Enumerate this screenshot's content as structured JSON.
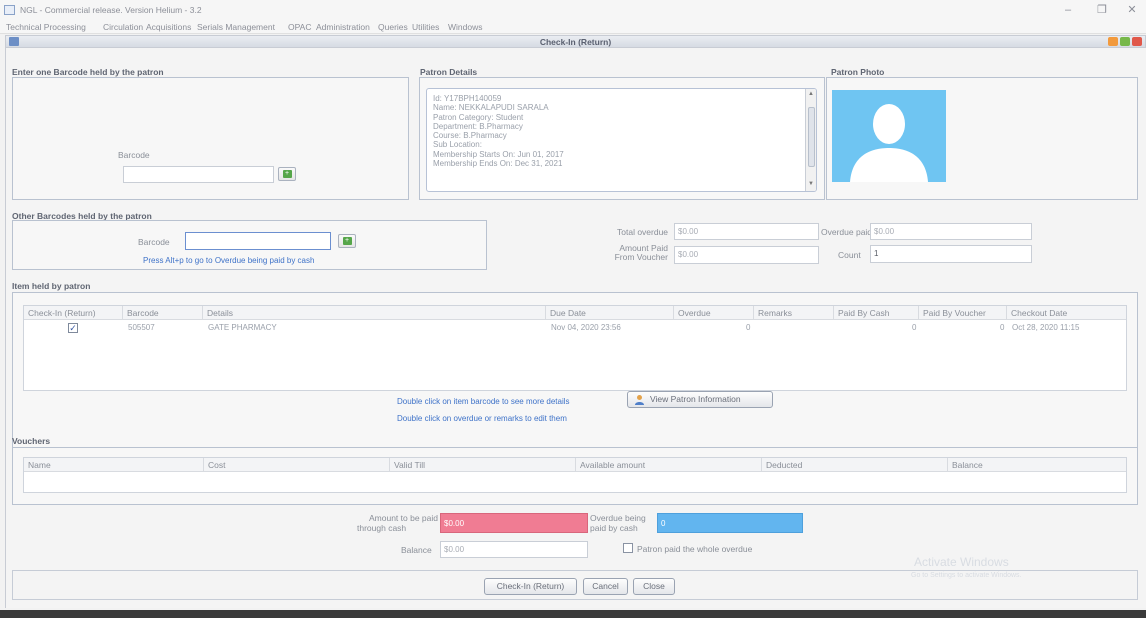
{
  "window": {
    "title": "NGL - Commercial release. Version Helium - 3.2"
  },
  "menu": [
    "Technical Processing",
    "Circulation",
    "Acquisitions",
    "Serials Management",
    "OPAC",
    "Administration",
    "Queries",
    "Utilities",
    "Windows"
  ],
  "dialog": {
    "title": "Check-In (Return)"
  },
  "barcode_section": {
    "title": "Enter one Barcode held by the patron",
    "label": "Barcode",
    "value": ""
  },
  "patron_details": {
    "title": "Patron Details",
    "lines": [
      "Id: Y17BPH140059",
      "Name: NEKKALAPUDI SARALA",
      "Patron Category: Student",
      "Department: B.Pharmacy",
      "Course: B.Pharmacy",
      "Sub Location:",
      "Membership Starts On: Jun 01, 2017",
      "Membership Ends On: Dec 31, 2021"
    ]
  },
  "patron_photo": {
    "title": "Patron Photo"
  },
  "other_barcodes": {
    "title": "Other Barcodes held by the patron",
    "label": "Barcode",
    "value": "",
    "hint": "Press Alt+p to go to Overdue being paid by cash"
  },
  "summary": {
    "total_overdue_label": "Total overdue",
    "total_overdue": "$0.00",
    "overdue_paid_label": "Overdue paid",
    "overdue_paid": "$0.00",
    "amount_paid_label1": "Amount Paid",
    "amount_paid_label2": "From Voucher",
    "amount_paid": "$0.00",
    "count_label": "Count",
    "count": "1"
  },
  "items": {
    "title": "Item held by patron",
    "columns": [
      "Check-In (Return)",
      "Barcode",
      "Details",
      "Due Date",
      "Overdue",
      "Remarks",
      "Paid By Cash",
      "Paid By Voucher",
      "Checkout Date"
    ],
    "rows": [
      {
        "checked": "✓",
        "barcode": "505507",
        "details": "GATE PHARMACY",
        "due_date": "Nov 04, 2020 23:56",
        "overdue": "0",
        "remarks": "",
        "paid_cash": "0",
        "paid_voucher": "0",
        "checkout_date": "Oct 28, 2020 11:15"
      }
    ],
    "hint1": "Double click on item barcode to see more details",
    "hint2": "Double click on overdue or remarks to edit them",
    "view_button": "View Patron Information"
  },
  "vouchers": {
    "title": "Vouchers",
    "columns": [
      "Name",
      "Cost",
      "Valid Till",
      "Available amount",
      "Deducted",
      "Balance"
    ]
  },
  "payment": {
    "amount_cash_label1": "Amount to be paid",
    "amount_cash_label2": "through cash",
    "amount_cash": "$0.00",
    "overdue_cash_label1": "Overdue being",
    "overdue_cash_label2": "paid by cash",
    "overdue_cash": "0",
    "balance_label": "Balance",
    "balance": "$0.00",
    "whole_overdue_label": "Patron paid the whole overdue"
  },
  "buttons": {
    "checkin": "Check-In (Return)",
    "cancel": "Cancel",
    "close": "Close"
  },
  "watermark": {
    "line1": "Activate Windows",
    "line2": "Go to Settings to activate Windows."
  },
  "colors": {
    "amount_cash_bg": "#f07c93",
    "overdue_cash_bg": "#62b5ef",
    "photo_bg": "#6fc5f2",
    "link": "#3e72c8"
  }
}
